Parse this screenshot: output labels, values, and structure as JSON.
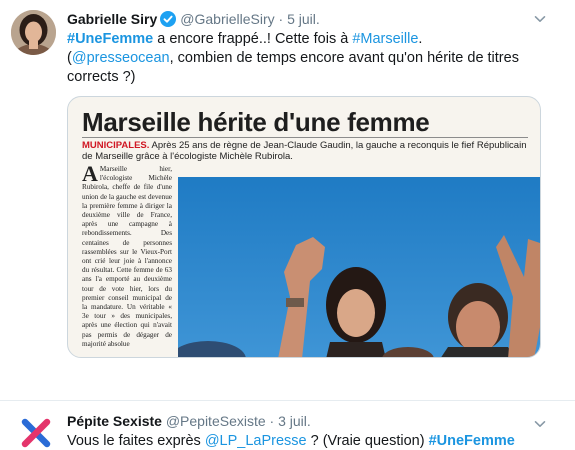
{
  "tweet1": {
    "name": "Gabrielle Siry",
    "handle": "@GabrielleSiry",
    "separator": "·",
    "time": "5 juil.",
    "text": {
      "hashtag1": "#UneFemme",
      "part1": " a encore frappé..! Cette fois à ",
      "hashtag2": "#Marseille",
      "part2": ".",
      "part3": "(",
      "mention": "@presseocean",
      "part4": ", combien de temps encore avant qu'on hérite de titres corrects ?)"
    },
    "media": {
      "headline": "Marseille hérite d'une femme",
      "kicker": "MUNICIPALES.",
      "lede": " Après 25 ans de règne de Jean-Claude Gaudin, la gauche a reconquis le fief Républicain de Marseille grâce à l'écologiste Michèle Rubirola.",
      "dropcap": "A",
      "column": "Marseille hier, l'écologiste Michèle Rubirola, cheffe de file d'une union de la gauche est devenue la première femme à diriger la deuxième ville de France, après une campagne à rebondissements. Des centaines de personnes rassemblées sur le Vieux-Port ont crié leur joie à l'annonce du résultat. Cette femme de 63 ans l'a emporté au deuxième tour de vote hier, lors du premier conseil municipal de la mandature. Un véritable « 3e tour » des municipales, après une élection qui n'avait pas permis de dégager de majorité absolue"
    }
  },
  "tweet2": {
    "name": "Pépite Sexiste",
    "handle": "@PepiteSexiste",
    "separator": "·",
    "time": "3 juil.",
    "text": {
      "part1": "Vous le faites exprès ",
      "mention": "@LP_LaPresse",
      "part2": " ? (Vraie question) ",
      "hashtag": "#UneFemme"
    }
  },
  "colors": {
    "link": "#1b95e0",
    "secondary_text": "#657786",
    "kicker_red": "#d01623",
    "logo_blue": "#2a6bd6",
    "logo_pink": "#e4346b"
  }
}
